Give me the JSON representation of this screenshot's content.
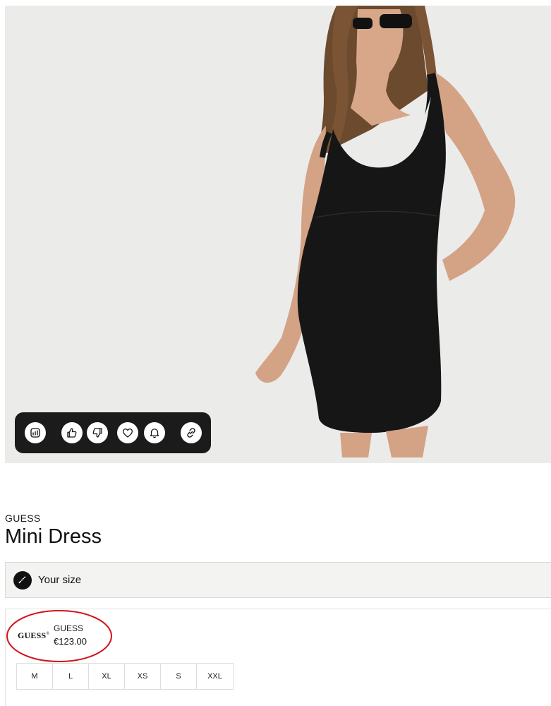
{
  "product": {
    "brand": "GUESS",
    "title": "Mini Dress"
  },
  "size_selector": {
    "label": "Your size",
    "icon": "ruler-icon"
  },
  "action_bar": {
    "icons": [
      "chart-icon",
      "thumbs-up-icon",
      "thumbs-down-icon",
      "heart-icon",
      "bell-icon",
      "link-icon"
    ]
  },
  "offer": {
    "logo_text": "GUESS",
    "brand": "GUESS",
    "price": "€123.00",
    "sizes": [
      "M",
      "L",
      "XL",
      "XS",
      "S",
      "XXL"
    ]
  },
  "colors": {
    "action_bar_bg": "#1b1b1b",
    "annotation": "#d0141c",
    "hero_bg": "#ebebea"
  }
}
